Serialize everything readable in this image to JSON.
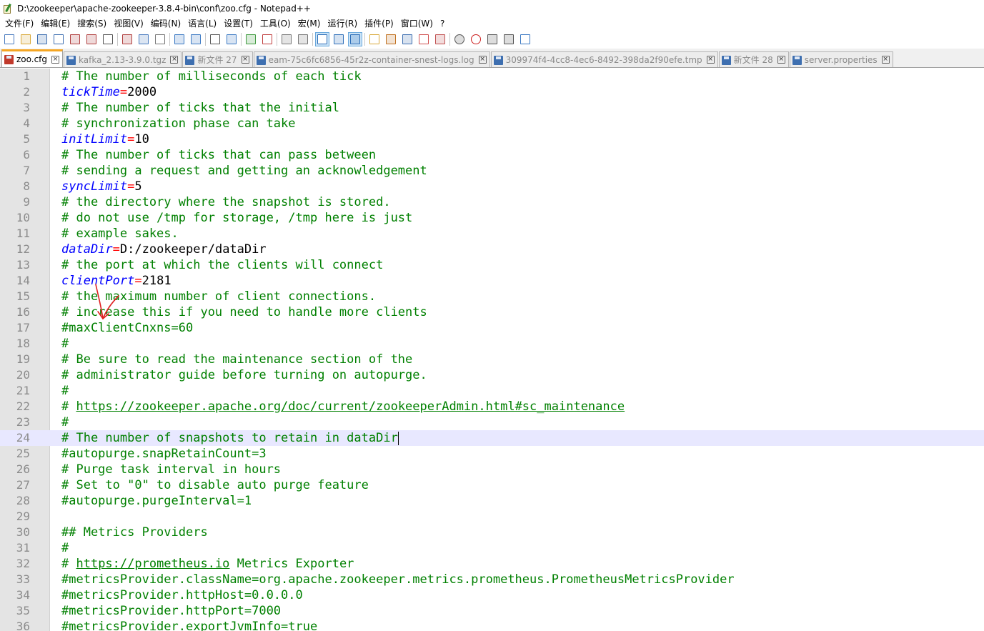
{
  "window": {
    "title": "D:\\zookeeper\\apache-zookeeper-3.8.4-bin\\conf\\zoo.cfg - Notepad++"
  },
  "menu": [
    "文件(F)",
    "编辑(E)",
    "搜索(S)",
    "视图(V)",
    "编码(N)",
    "语言(L)",
    "设置(T)",
    "工具(O)",
    "宏(M)",
    "运行(R)",
    "插件(P)",
    "窗口(W)",
    "?"
  ],
  "toolbar": {
    "icons": [
      "new-file-icon",
      "open-file-icon",
      "save-icon",
      "save-all-icon",
      "close-icon",
      "close-all-icon",
      "print-icon",
      "cut-icon",
      "copy-icon",
      "paste-icon",
      "undo-icon",
      "redo-icon",
      "find-icon",
      "replace-icon",
      "zoom-in-icon",
      "zoom-out-icon",
      "sync-vertical-icon",
      "sync-horizontal-icon",
      "word-wrap-icon",
      "show-all-chars-icon",
      "indent-guide-icon",
      "function-list-icon",
      "document-map-icon",
      "folder-workspace-icon",
      "doc-list-icon",
      "monitoring-icon",
      "record-macro-icon",
      "stop-record-icon",
      "play-macro-icon",
      "run-macro-multiple-icon",
      "save-macro-icon"
    ]
  },
  "tabs": [
    {
      "label": "zoo.cfg",
      "active": true
    },
    {
      "label": "kafka_2.13-3.9.0.tgz",
      "active": false
    },
    {
      "label": "新文件 27",
      "active": false
    },
    {
      "label": "eam-75c6fc6856-45r2z-container-snest-logs.log",
      "active": false
    },
    {
      "label": "309974f4-4cc8-4ec6-8492-398da2f90efe.tmp",
      "active": false
    },
    {
      "label": "新文件 28",
      "active": false
    },
    {
      "label": "server.properties",
      "active": false
    }
  ],
  "editor": {
    "current_line": 24,
    "lines": [
      {
        "n": "1",
        "type": "comment",
        "text": "# The number of milliseconds of each tick"
      },
      {
        "n": "2",
        "type": "kv",
        "key": "tickTime",
        "value": "2000"
      },
      {
        "n": "3",
        "type": "comment",
        "text": "# The number of ticks that the initial"
      },
      {
        "n": "4",
        "type": "comment",
        "text": "# synchronization phase can take"
      },
      {
        "n": "5",
        "type": "kv",
        "key": "initLimit",
        "value": "10"
      },
      {
        "n": "6",
        "type": "comment",
        "text": "# The number of ticks that can pass between"
      },
      {
        "n": "7",
        "type": "comment",
        "text": "# sending a request and getting an acknowledgement"
      },
      {
        "n": "8",
        "type": "kv",
        "key": "syncLimit",
        "value": "5"
      },
      {
        "n": "9",
        "type": "comment",
        "text": "# the directory where the snapshot is stored."
      },
      {
        "n": "10",
        "type": "comment",
        "text": "# do not use /tmp for storage, /tmp here is just"
      },
      {
        "n": "11",
        "type": "comment",
        "text": "# example sakes."
      },
      {
        "n": "12",
        "type": "kv",
        "key": "dataDir",
        "value": "D:/zookeeper/dataDir"
      },
      {
        "n": "13",
        "type": "comment",
        "text": "# the port at which the clients will connect"
      },
      {
        "n": "14",
        "type": "kv",
        "key": "clientPort",
        "value": "2181"
      },
      {
        "n": "15",
        "type": "comment",
        "text": "# the maximum number of client connections."
      },
      {
        "n": "16",
        "type": "comment",
        "text": "# increase this if you need to handle more clients"
      },
      {
        "n": "17",
        "type": "comment",
        "text": "#maxClientCnxns=60"
      },
      {
        "n": "18",
        "type": "comment",
        "text": "#"
      },
      {
        "n": "19",
        "type": "comment",
        "text": "# Be sure to read the maintenance section of the"
      },
      {
        "n": "20",
        "type": "comment",
        "text": "# administrator guide before turning on autopurge."
      },
      {
        "n": "21",
        "type": "comment",
        "text": "#"
      },
      {
        "n": "22",
        "type": "link",
        "prefix": "# ",
        "link": "https://zookeeper.apache.org/doc/current/zookeeperAdmin.html#sc_maintenance",
        "suffix": ""
      },
      {
        "n": "23",
        "type": "comment",
        "text": "#"
      },
      {
        "n": "24",
        "type": "comment",
        "text": "# The number of snapshots to retain in dataDir"
      },
      {
        "n": "25",
        "type": "comment",
        "text": "#autopurge.snapRetainCount=3"
      },
      {
        "n": "26",
        "type": "comment",
        "text": "# Purge task interval in hours"
      },
      {
        "n": "27",
        "type": "comment",
        "text": "# Set to \"0\" to disable auto purge feature"
      },
      {
        "n": "28",
        "type": "comment",
        "text": "#autopurge.purgeInterval=1"
      },
      {
        "n": "29",
        "type": "empty",
        "text": ""
      },
      {
        "n": "30",
        "type": "comment",
        "text": "## Metrics Providers"
      },
      {
        "n": "31",
        "type": "comment",
        "text": "#"
      },
      {
        "n": "32",
        "type": "link",
        "prefix": "# ",
        "link": "https://prometheus.io",
        "suffix": " Metrics Exporter"
      },
      {
        "n": "33",
        "type": "comment",
        "text": "#metricsProvider.className=org.apache.zookeeper.metrics.prometheus.PrometheusMetricsProvider"
      },
      {
        "n": "34",
        "type": "comment",
        "text": "#metricsProvider.httpHost=0.0.0.0"
      },
      {
        "n": "35",
        "type": "comment",
        "text": "#metricsProvider.httpPort=7000"
      },
      {
        "n": "36",
        "type": "comment",
        "text": "#metricsProvider.exportJvmInfo=true"
      }
    ]
  },
  "colors": {
    "comment": "#008000",
    "key": "#0000ff",
    "operator": "#ff0000",
    "active_tab_accent": "#f5a623",
    "current_line_bg": "#e8e8ff",
    "annotation": "#e02020"
  }
}
